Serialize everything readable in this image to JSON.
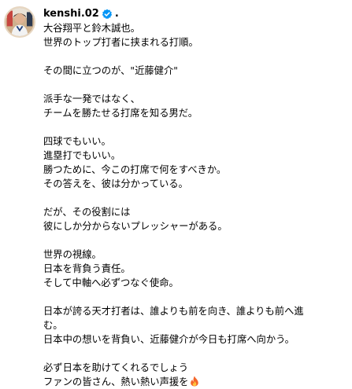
{
  "post": {
    "username": "kenshi.02",
    "separator": ".",
    "verified_color": "#0095f6",
    "caption_lines": [
      "大谷翔平と鈴木誠也。",
      "世界のトップ打者に挟まれる打順。",
      "",
      "その間に立つのが、\"近藤健介\"",
      "",
      "派手な一発ではなく、",
      "チームを勝たせる打席を知る男だ。",
      "",
      "四球でもいい。",
      "進塁打でもいい。",
      "勝つために、今この打席で何をすべきか。",
      "その答えを、彼は分かっている。",
      "",
      "だが、その役割には",
      "彼にしか分からないプレッシャーがある。",
      "",
      "世界の視線。",
      "日本を背負う責任。",
      "そして中軸へ必ずつなぐ使命。",
      "",
      "日本が誇る天才打者は、誰よりも前を向き、誰よりも前へ進",
      "む。",
      "日本中の想いを背負い、近藤健介が今日も打席へ向かう。",
      "",
      "必ず日本を助けてくれるでしょう",
      "ファンの皆さん、熱い熱い声援を"
    ],
    "final_emoji_icon": "fire-icon"
  }
}
